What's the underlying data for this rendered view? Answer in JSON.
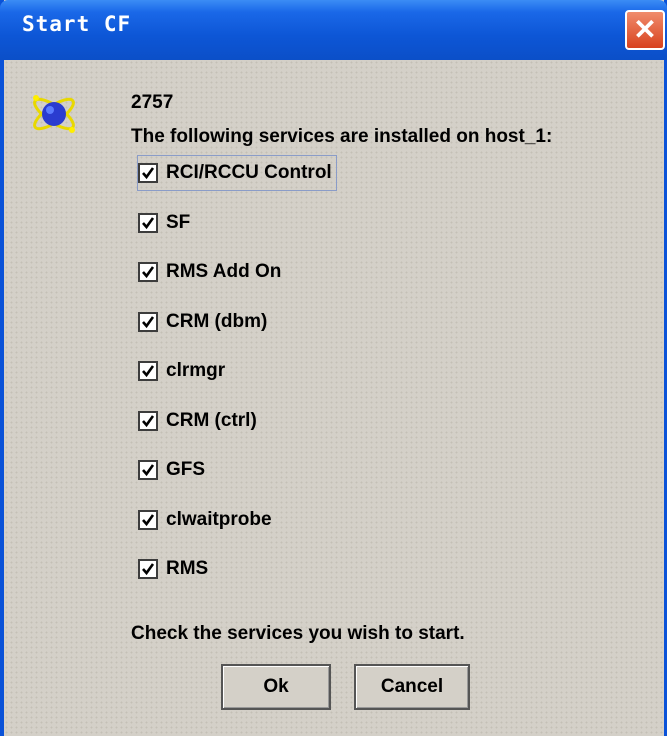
{
  "window": {
    "title": "Start CF",
    "close_glyph": "✕"
  },
  "message": {
    "id": "2757",
    "text": "The following services are installed on host_1:",
    "icon": "cluster-atom-icon"
  },
  "services": [
    {
      "label": "RCI/RCCU Control",
      "checked": true
    },
    {
      "label": "SF",
      "checked": true
    },
    {
      "label": "RMS Add On",
      "checked": true
    },
    {
      "label": "CRM (dbm)",
      "checked": true
    },
    {
      "label": "clrmgr",
      "checked": true
    },
    {
      "label": "CRM (ctrl)",
      "checked": true
    },
    {
      "label": "GFS",
      "checked": true
    },
    {
      "label": "clwaitprobe",
      "checked": true
    },
    {
      "label": "RMS",
      "checked": true
    }
  ],
  "hint": "Check the services you wish to start.",
  "buttons": {
    "ok": "Ok",
    "cancel": "Cancel"
  },
  "colors": {
    "titlebar": "#0b4fc8",
    "close": "#d8421e",
    "dialog_bg": "#d4d0c8"
  }
}
